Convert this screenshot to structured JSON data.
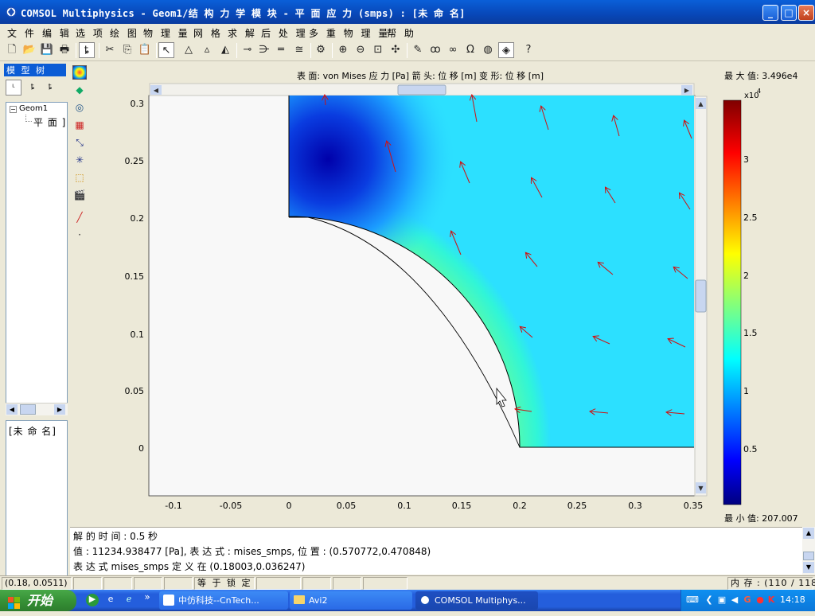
{
  "window": {
    "title": "COMSOL Multiphysics - Geom1/结 构 力 学 模 块 - 平 面 应 力 (smps) : [未 命 名]",
    "minimize_icon": "minimize-icon",
    "maximize_icon": "maximize-icon",
    "close_icon": "close-icon"
  },
  "menu": {
    "items": [
      "文 件",
      "编 辑",
      "选 项",
      "绘 图",
      "物 理 量",
      "网 格",
      "求 解",
      "后 处 理",
      "多 重 物 理 量",
      "帮 助"
    ]
  },
  "toolbar": {
    "icons": [
      "new-icon",
      "open-icon",
      "save-icon",
      "print-icon",
      "tree-view-icon",
      "cut-icon",
      "copy-icon",
      "paste-icon",
      "select-icon",
      "triangle-mesh-icon",
      "refine-mesh-icon",
      "mesh-select-icon",
      "boundary-settings-icon",
      "subdomain-settings-icon",
      "equals-icon",
      "point-settings-icon",
      "solve-icon",
      "zoom-in-icon",
      "zoom-out-icon",
      "zoom-window-icon",
      "zoom-extents-icon",
      "draw-mode-icon",
      "multiphysics-icon",
      "coupled-icon",
      "omega-icon",
      "sphere-icon",
      "plot-icon",
      "help-icon"
    ]
  },
  "model_tree": {
    "header": "模 型 树",
    "items": [
      "Geom1",
      "平 面 ]"
    ]
  },
  "properties": {
    "text": "[未 命 名]"
  },
  "plot": {
    "header": "表 面: von Mises 应 力 [Pa]   箭 头: 位 移 [m]   变 形: 位 移 [m]",
    "max_label": "最 大 值: 3.496e4",
    "min_label": "最 小 值: 207.007",
    "colorbar_exponent": "x10",
    "colorbar_exponent_power": "4",
    "colorbar_ticks": [
      "0.5",
      "1",
      "1.5",
      "2",
      "2.5",
      "3"
    ],
    "x_ticks": [
      "-0.1",
      "-0.05",
      "0",
      "0.05",
      "0.1",
      "0.15",
      "0.2",
      "0.25",
      "0.3",
      "0.35"
    ],
    "y_ticks": [
      "0",
      "0.05",
      "0.1",
      "0.15",
      "0.2",
      "0.25",
      "0.3"
    ]
  },
  "chart_data": {
    "type": "heatmap",
    "title": "表 面: von Mises 应 力 [Pa]   箭 头: 位 移 [m]   变 形: 位 移 [m]",
    "xlim": [
      -0.12,
      0.355
    ],
    "ylim": [
      -0.04,
      0.305
    ],
    "colorbar_range": [
      207.007,
      34960
    ],
    "colorbar_ticks": [
      5000,
      10000,
      15000,
      20000,
      25000,
      30000
    ],
    "colormap": "jet",
    "hole_radius": 0.18,
    "plate_outline": [
      [
        0,
        0.2
      ],
      [
        0,
        0.305
      ],
      [
        0.355,
        0.305
      ],
      [
        0.355,
        0
      ],
      [
        0.2,
        0
      ]
    ]
  },
  "info": {
    "line1": "解 的 时 间 : 0.5 秒",
    "line2": "值 : 11234.938477 [Pa], 表 达 式 : mises_smps, 位 置 : (0.570772,0.470848)",
    "line3": "表 达 式 mises_smps 定 义 在 (0.18003,0.036247)"
  },
  "status": {
    "coords": "(0.18, 0.0511)",
    "equal": "等 于",
    "lock": "锁 定",
    "memory": "内 存 :",
    "memory_value": "(110 / 118)"
  },
  "taskbar": {
    "start": "开始",
    "tasks": [
      "中仿科技--CnTech...",
      "Avi2",
      "COMSOL Multiphys..."
    ],
    "clock": "14:18"
  }
}
